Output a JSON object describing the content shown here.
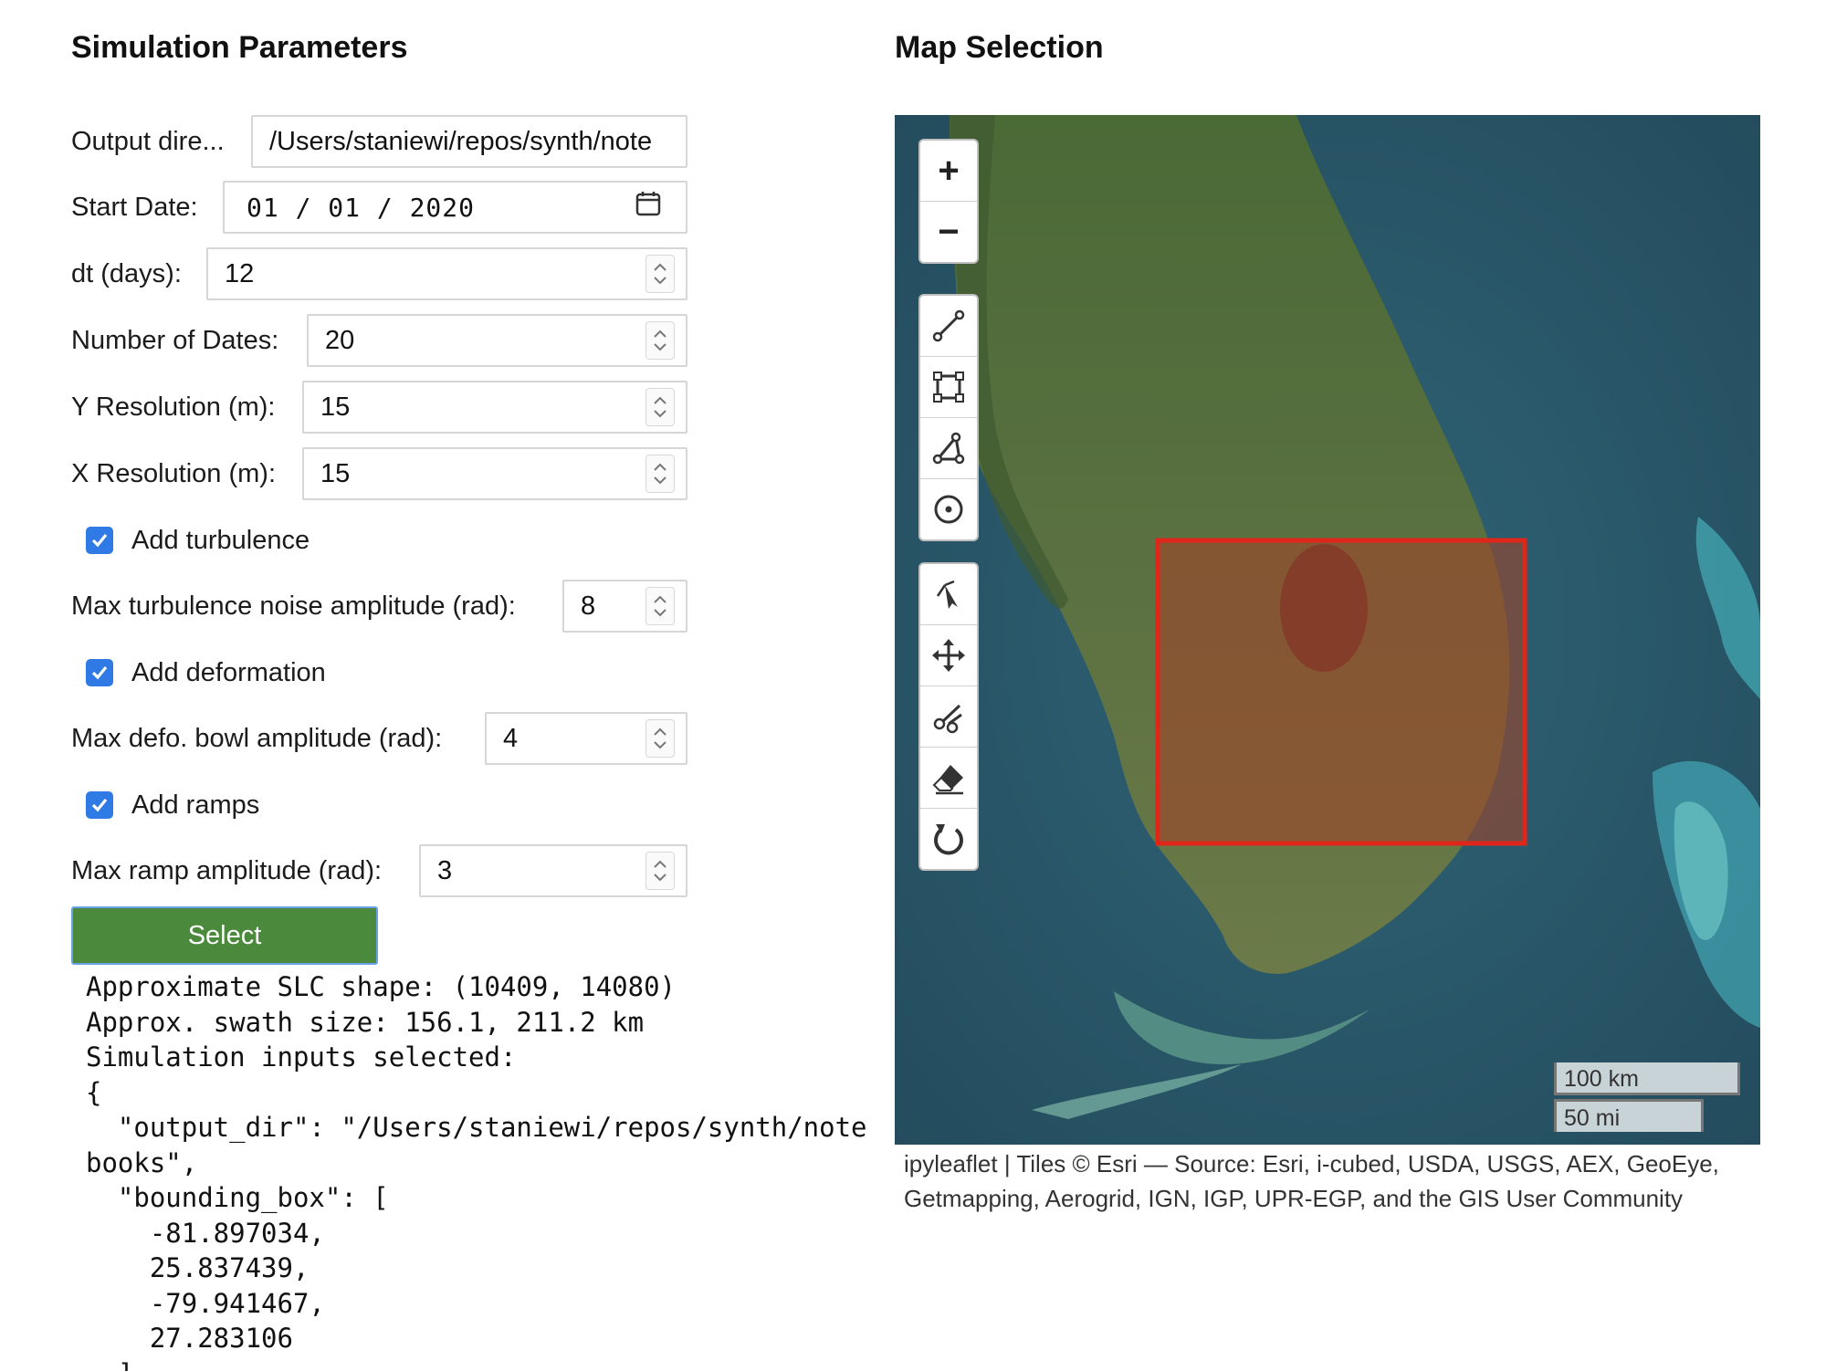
{
  "left_panel": {
    "title": "Simulation Parameters",
    "output_dir": {
      "label": "Output dire...",
      "value": "/Users/staniewi/repos/synth/note"
    },
    "start_date": {
      "label": "Start Date:",
      "value": "01 / 01 / 2020"
    },
    "dt_days": {
      "label": "dt (days):",
      "value": "12"
    },
    "num_dates": {
      "label": "Number of Dates:",
      "value": "20"
    },
    "y_res": {
      "label": "Y Resolution (m):",
      "value": "15"
    },
    "x_res": {
      "label": "X Resolution (m):",
      "value": "15"
    },
    "add_turbulence": {
      "label": "Add turbulence",
      "checked": true
    },
    "max_turb": {
      "label": "Max turbulence noise amplitude (rad):",
      "value": "8"
    },
    "add_deformation": {
      "label": "Add deformation",
      "checked": true
    },
    "max_defo": {
      "label": "Max defo. bowl amplitude (rad):",
      "value": "4"
    },
    "add_ramps": {
      "label": "Add ramps",
      "checked": true
    },
    "max_ramp": {
      "label": "Max ramp amplitude (rad):",
      "value": "3"
    },
    "select_button": "Select",
    "output_text": "Approximate SLC shape: (10409, 14080)\nApprox. swath size: 156.1, 211.2 km\nSimulation inputs selected:\n{\n  \"output_dir\": \"/Users/staniewi/repos/synth/note\nbooks\",\n  \"bounding_box\": [\n    -81.897034,\n    25.837439,\n    -79.941467,\n    27.283106\n  ],"
  },
  "map_panel": {
    "title": "Map Selection",
    "zoom_in": "+",
    "zoom_out": "−",
    "draw_tools": [
      "polyline-icon",
      "rectangle-icon",
      "polygon-icon",
      "circlemarker-icon"
    ],
    "edit_tools": [
      "select-icon",
      "move-icon",
      "cut-icon",
      "eraser-icon",
      "rotate-icon"
    ],
    "scale_km": "100 km",
    "scale_mi": "50 mi",
    "attribution": "ipyleaflet | Tiles © Esri — Source: Esri, i-cubed, USDA, USGS, AEX, GeoEye, Getmapping, Aerogrid, IGN, IGP, UPR-EGP, and the GIS User Community"
  },
  "colors": {
    "select_button": "#4b8a3c",
    "checkbox": "#2f7ae5",
    "selection_rect": "#e0261b"
  }
}
